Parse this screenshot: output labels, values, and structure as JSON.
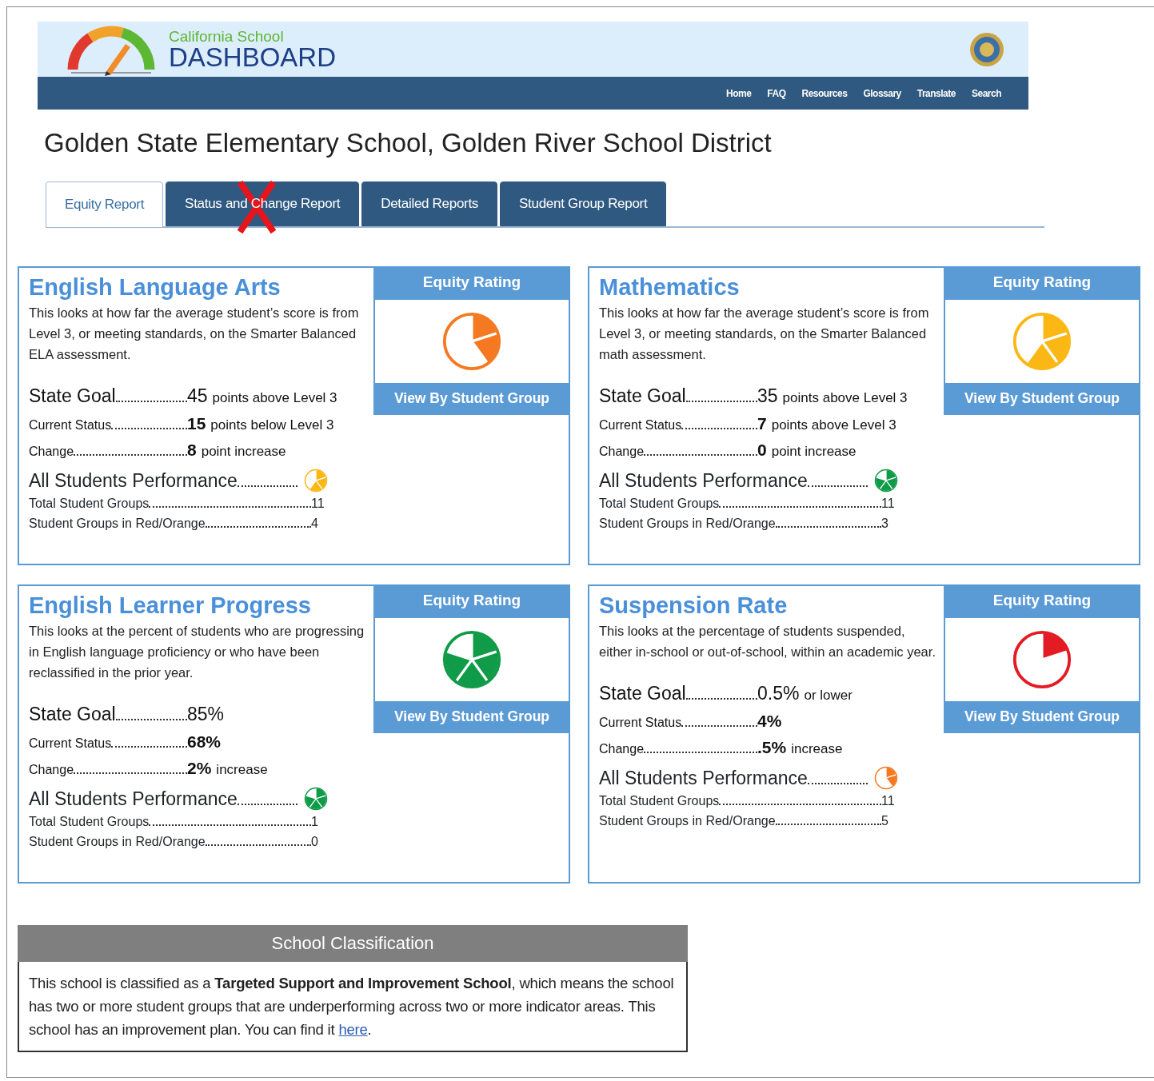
{
  "header": {
    "logo_top": "California School",
    "logo_main": "DASHBOARD",
    "nav": [
      "Home",
      "FAQ",
      "Resources",
      "Glossary",
      "Translate",
      "Search"
    ]
  },
  "page_title": "Golden State Elementary School, Golden River School District",
  "tabs": [
    {
      "label": "Equity Report",
      "selected": true,
      "crossed_out": false
    },
    {
      "label": "Status and Change Report",
      "selected": false,
      "crossed_out": true
    },
    {
      "label": "Detailed Reports",
      "selected": false,
      "crossed_out": false
    },
    {
      "label": "Student Group Report",
      "selected": false,
      "crossed_out": false
    }
  ],
  "cards": [
    {
      "title": "English Language Arts",
      "description": "This looks at how far the average student’s score is from Level 3, or meeting standards, on the Smarter Balanced ELA assessment.",
      "equity_heading": "Equity Rating",
      "equity_rating": {
        "color": "#f47920"
      },
      "button": "View By Student Group",
      "stats": [
        {
          "kind": "major",
          "label": "State Goal",
          "value": "45",
          "unit": "points above Level 3"
        },
        {
          "kind": "minor",
          "label": "Current Status",
          "value": "15",
          "unit": "points below Level 3"
        },
        {
          "kind": "minor",
          "label": "Change",
          "value": "8",
          "unit": "point increase"
        }
      ],
      "performance": {
        "label": "All Students Performance",
        "color": "#fbb713"
      },
      "counts": [
        {
          "label": "Total Student Groups",
          "value": "11"
        },
        {
          "label": "Student Groups in Red/Orange",
          "value": "4"
        }
      ]
    },
    {
      "title": "Mathematics",
      "description": "This looks at how far the average student’s score is from Level 3, or meeting standards, on the Smarter Balanced math assessment.",
      "equity_heading": "Equity Rating",
      "equity_rating": {
        "color": "#fbb713"
      },
      "button": "View By Student Group",
      "stats": [
        {
          "kind": "major",
          "label": "State Goal",
          "value": "35",
          "unit": "points above Level 3"
        },
        {
          "kind": "minor",
          "label": "Current Status",
          "value": "7",
          "unit": "points above Level 3"
        },
        {
          "kind": "minor",
          "label": "Change",
          "value": "0",
          "unit": "point increase"
        }
      ],
      "performance": {
        "label": "All Students Performance",
        "color": "#0f9b48"
      },
      "counts": [
        {
          "label": "Total Student Groups",
          "value": "11"
        },
        {
          "label": "Student Groups in Red/Orange",
          "value": "3"
        }
      ]
    },
    {
      "title": "English Learner Progress",
      "description": "This looks at the percent of students who are progressing in English language proficiency or who have been reclassified in the prior year.",
      "equity_heading": "Equity Rating",
      "equity_rating": {
        "color": "#0f9b48"
      },
      "button": "View By Student Group",
      "stats": [
        {
          "kind": "major",
          "label": "State Goal",
          "value": "85%"
        },
        {
          "kind": "minor",
          "label": "Current Status",
          "value": "68%"
        },
        {
          "kind": "minor",
          "label": "Change",
          "value": "2%",
          "unit": "increase"
        }
      ],
      "performance": {
        "label": "All Students Performance",
        "color": "#0f9b48"
      },
      "counts": [
        {
          "label": "Total Student Groups",
          "value": "1"
        },
        {
          "label": "Student Groups in Red/Orange",
          "value": "0"
        }
      ]
    },
    {
      "title": "Suspension Rate",
      "description": "This looks at the percentage of students suspended, either in-school or out-of-school, within an academic year.",
      "equity_heading": "Equity Rating",
      "equity_rating": {
        "color": "#e31b23"
      },
      "button": "View By Student Group",
      "stats": [
        {
          "kind": "major",
          "label": "State Goal",
          "value": "0.5%",
          "unit": "or lower"
        },
        {
          "kind": "minor",
          "label": "Current Status",
          "value": "4%"
        },
        {
          "kind": "minor",
          "label": "Change",
          "value": ".5%",
          "unit": "increase"
        }
      ],
      "performance": {
        "label": "All Students Performance",
        "color": "#f47920"
      },
      "counts": [
        {
          "label": "Total Student Groups",
          "value": "11"
        },
        {
          "label": "Student Groups in Red/Orange",
          "value": "5"
        }
      ]
    }
  ],
  "classification": {
    "heading": "School Classification",
    "text": "This school is classified as a **Targeted Support and Improvement School**, which means the school has two or more student groups that are underperforming across two or more indicator areas. This school has an improvement plan. You can find it",
    "link": "here",
    "after": "."
  }
}
